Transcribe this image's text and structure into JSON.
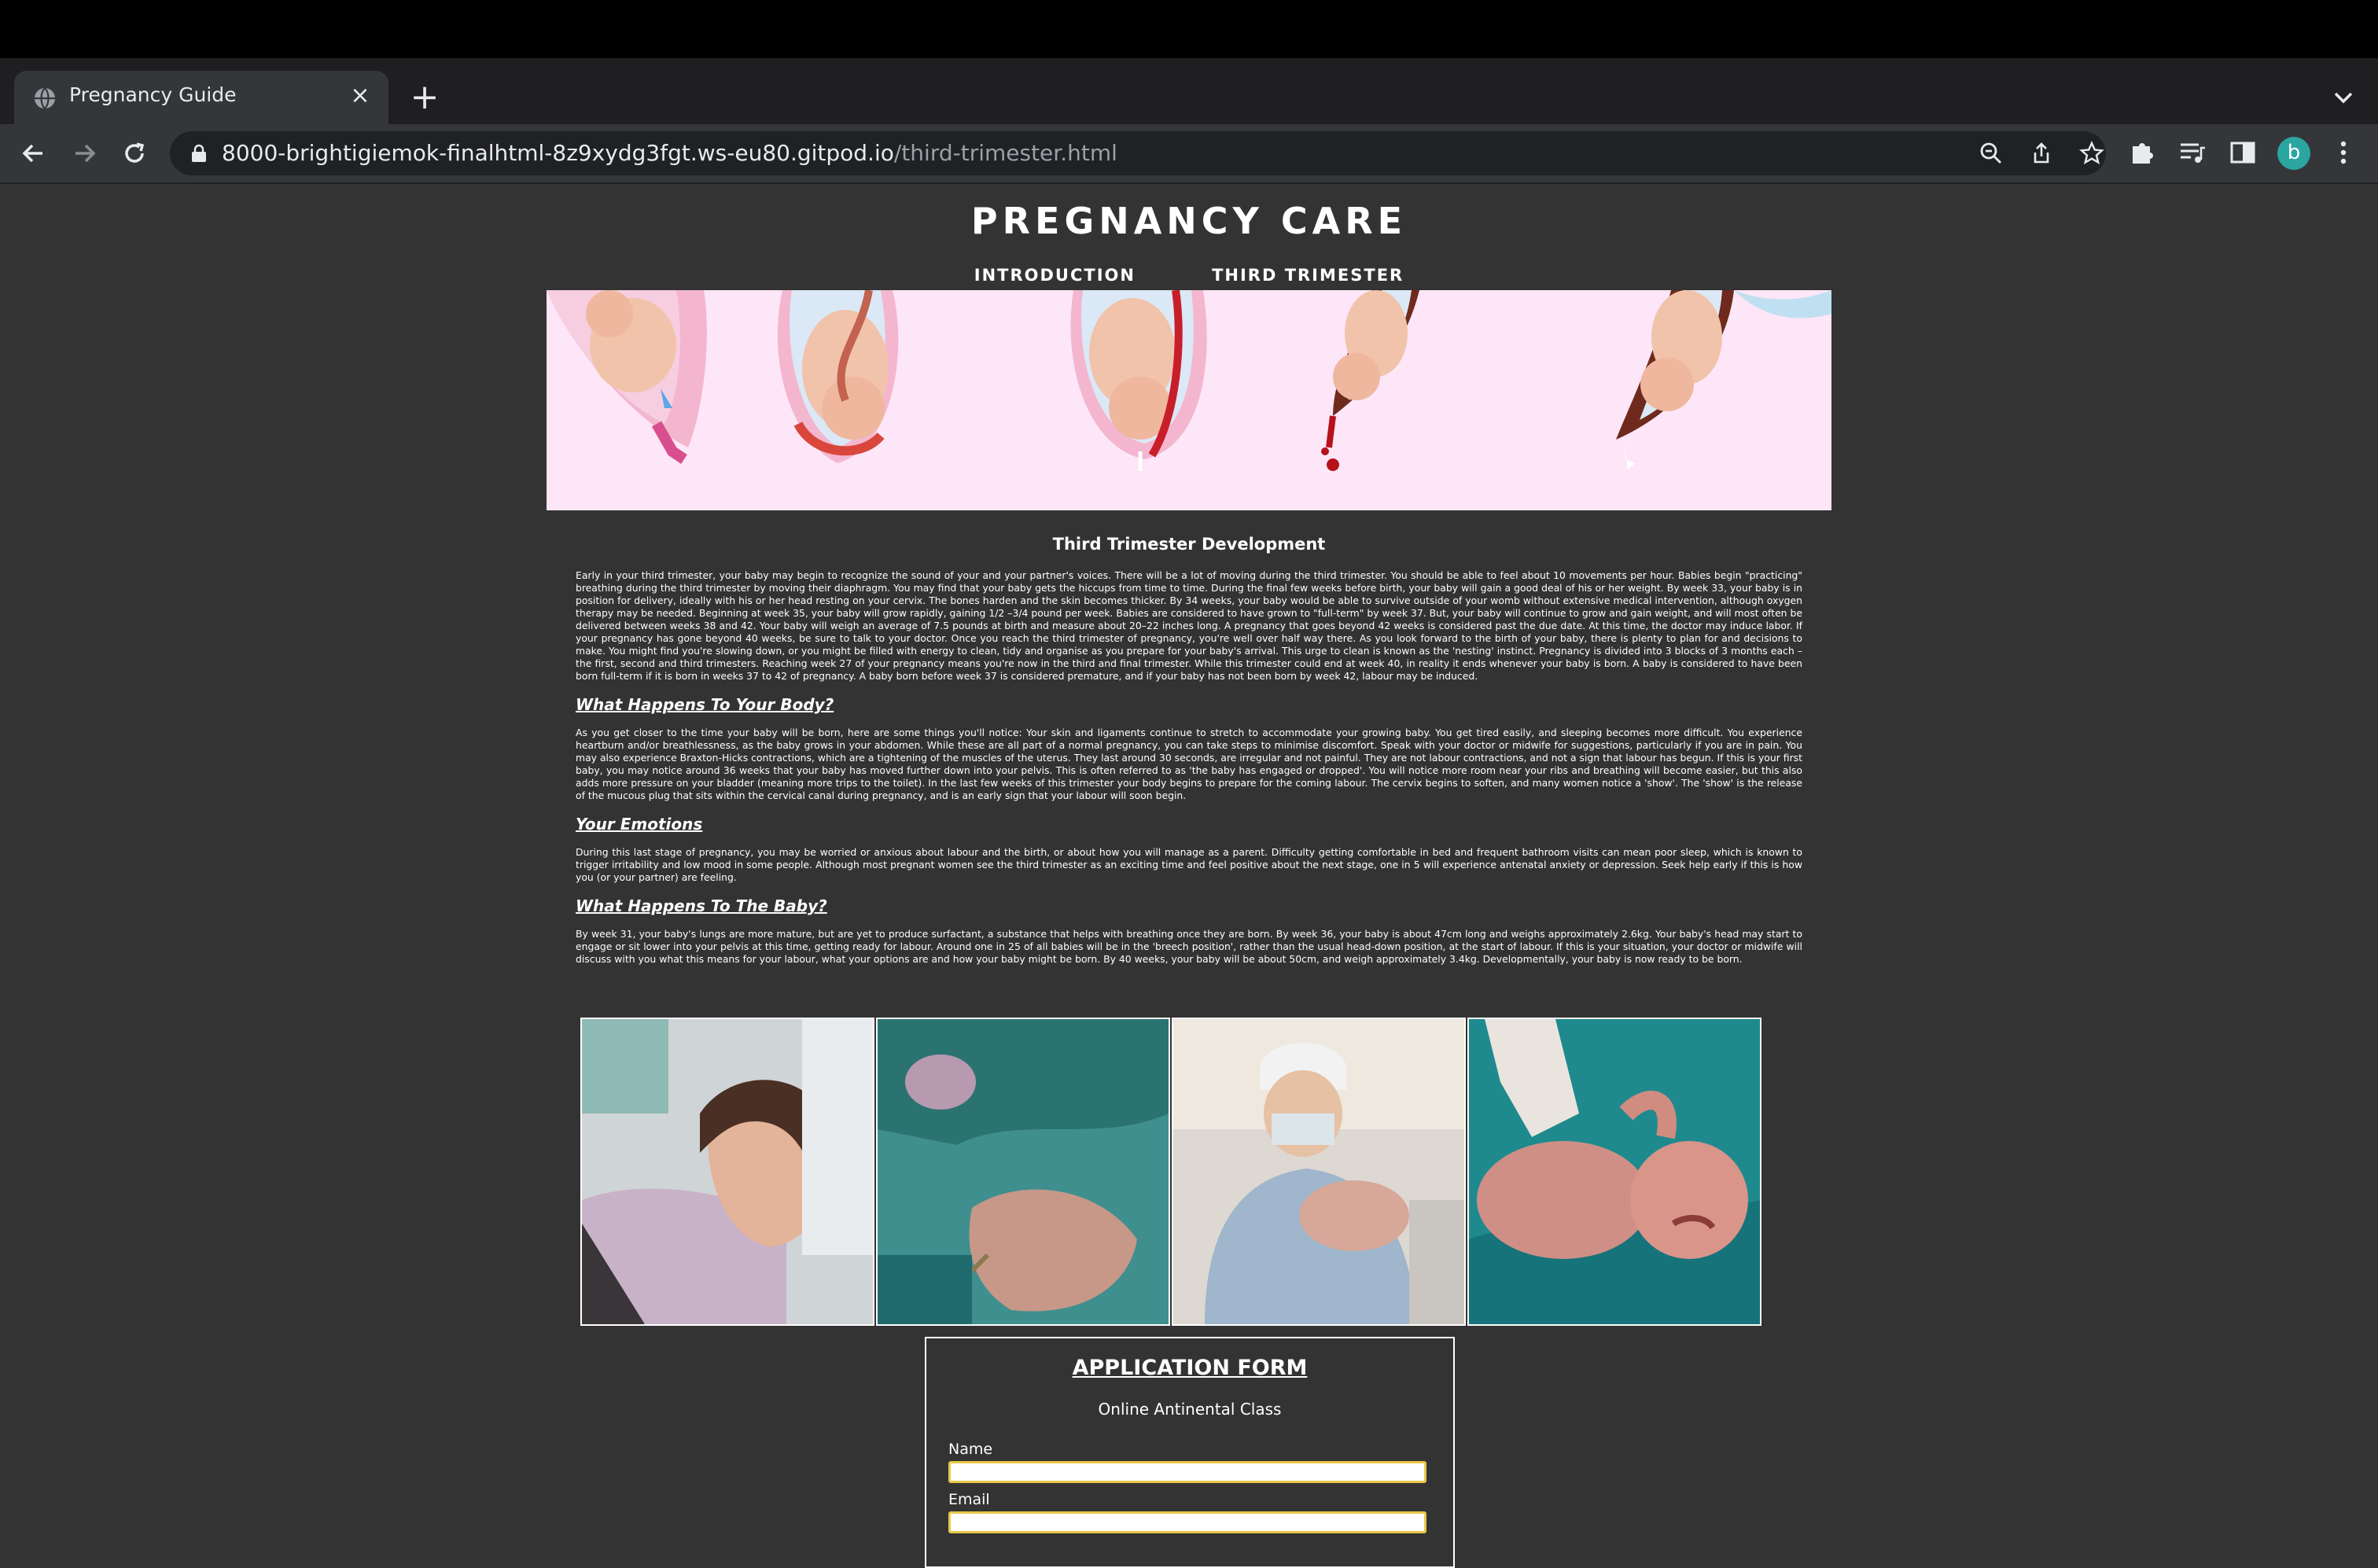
{
  "browser": {
    "tab_title": "Pregnancy Guide",
    "new_tab_label": "+",
    "close_label": "×",
    "url_host": "8000-brightigiemok-finalhtml-8z9xydg3fgt.ws-eu80.gitpod.io",
    "url_path": "/third-trimester.html",
    "profile_initial": "b"
  },
  "site": {
    "title": "PREGNANCY CARE",
    "nav": [
      "INTRODUCTION",
      "THIRD TRIMESTER"
    ]
  },
  "article": {
    "title": "Third Trimester Development",
    "intro": "Early in your third trimester, your baby may begin to recognize the sound of your and your partner's voices. There will be a lot of moving during the third trimester. You should be able to feel about 10 movements per hour. Babies begin \"practicing\" breathing during the third trimester by moving their diaphragm. You may find that your baby gets the hiccups from time to time. During the final few weeks before birth, your baby will gain a good deal of his or her weight. By week 33, your baby is in position for delivery, ideally with his or her head resting on your cervix. The bones harden and the skin becomes thicker. By 34 weeks, your baby would be able to survive outside of your womb without extensive medical intervention, although oxygen therapy may be needed. Beginning at week 35, your baby will grow rapidly, gaining 1/2 –3/4 pound per week. Babies are considered to have grown to \"full-term\" by week 37. But, your baby will continue to grow and gain weight, and will most often be delivered between weeks 38 and 42. Your baby will weigh an average of 7.5 pounds at birth and measure about 20–22 inches long. A pregnancy that goes beyond 42 weeks is considered past the due date. At this time, the doctor may induce labor. If your pregnancy has gone beyond 40 weeks, be sure to talk to your doctor. Once you reach the third trimester of pregnancy, you're well over half way there. As you look forward to the birth of your baby, there is plenty to plan for and decisions to make. You might find you're slowing down, or you might be filled with energy to clean, tidy and organise as you prepare for your baby's arrival. This urge to clean is known as the 'nesting' instinct. Pregnancy is divided into 3 blocks of 3 months each – the first, second and third trimesters. Reaching week 27 of your pregnancy means you're now in the third and final trimester. While this trimester could end at week 40, in reality it ends whenever your baby is born. A baby is considered to have been born full-term if it is born in weeks 37 to 42 of pregnancy. A baby born before week 37 is considered premature, and if your baby has not been born by week 42, labour may be induced.",
    "body_heading": "What Happens To Your Body?",
    "body_text": "As you get closer to the time your baby will be born, here are some things you'll notice: Your skin and ligaments continue to stretch to accommodate your growing baby. You get tired easily, and sleeping becomes more difficult. You experience heartburn and/or breathlessness, as the baby grows in your abdomen. While these are all part of a normal pregnancy, you can take steps to minimise discomfort. Speak with your doctor or midwife for suggestions, particularly if you are in pain. You may also experience Braxton-Hicks contractions, which are a tightening of the muscles of the uterus. They last around 30 seconds, are irregular and not painful. They are not labour contractions, and not a sign that labour has begun. If this is your first baby, you may notice around 36 weeks that your baby has moved further down into your pelvis. This is often referred to as 'the baby has engaged or dropped'. You will notice more room near your ribs and breathing will become easier, but this also adds more pressure on your bladder (meaning more trips to the toilet). In the last few weeks of this trimester your body begins to prepare for the coming labour. The cervix begins to soften, and many women notice a 'show'. The 'show' is the release of the mucous plug that sits within the cervical canal during pregnancy, and is an early sign that your labour will soon begin.",
    "emotions_heading": "Your Emotions",
    "emotions_text": "During this last stage of pregnancy, you may be worried or anxious about labour and the birth, or about how you will manage as a parent. Difficulty getting comfortable in bed and frequent bathroom visits can mean poor sleep, which is known to trigger irritability and low mood in some people. Although most pregnant women see the third trimester as an exciting time and feel positive about the next stage, one in 5 will experience antenatal anxiety or depression. Seek help early if this is how you (or your partner) are feeling.",
    "baby_heading": "What Happens To The Baby?",
    "baby_text": "By week 31, your baby's lungs are more mature, but are yet to produce surfactant, a substance that helps with breathing once they are born. By week 36, your baby is about 47cm long and weighs approximately 2.6kg. Your baby's head may start to engage or sit lower into your pelvis at this time, getting ready for labour. Around one in 25 of all babies will be in the 'breech position', rather than the usual head-down position, at the start of labour. If this is your situation, your doctor or midwife will discuss with you what this means for your labour, what your options are and how your baby might be born. By 40 weeks, your baby will be about 50cm, and weigh approximately 3.4kg. Developmentally, your baby is now ready to be born."
  },
  "form": {
    "title": "APPLICATION FORM",
    "subtitle": "Online Antinental Class",
    "name_label": "Name",
    "email_label": "Email"
  },
  "colors": {
    "page_bg": "#333333",
    "banner_bg": "#fde6f7",
    "input_border": "#e8c84a"
  }
}
